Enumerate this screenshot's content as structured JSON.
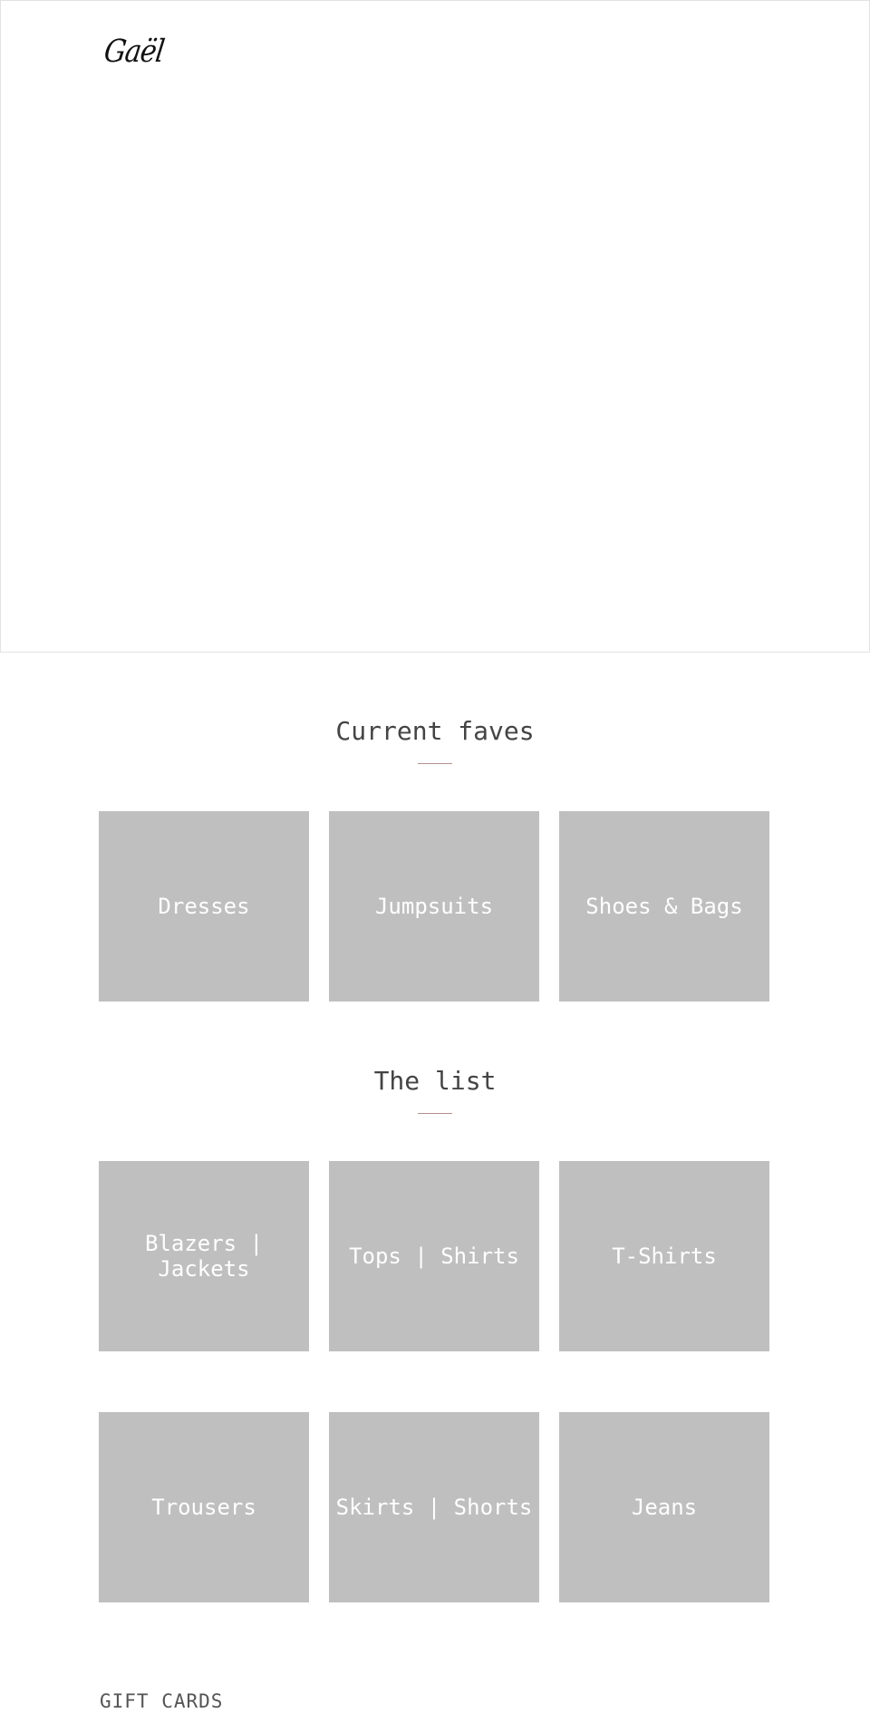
{
  "header": {
    "logo_text": "Gaël"
  },
  "sections": [
    {
      "title": "Current faves",
      "cards": [
        {
          "label": "Dresses"
        },
        {
          "label": "Jumpsuits"
        },
        {
          "label": "Shoes & Bags"
        }
      ]
    },
    {
      "title": "The list",
      "cards": [
        {
          "label": "Blazers | Jackets"
        },
        {
          "label": "Tops | Shirts"
        },
        {
          "label": "T-Shirts"
        },
        {
          "label": "Trousers"
        },
        {
          "label": "Skirts | Shorts"
        },
        {
          "label": "Jeans"
        }
      ]
    }
  ],
  "footer": {
    "gift_cards_heading": "GIFT CARDS"
  },
  "colors": {
    "card_background": "#bfbfbf",
    "accent_rule": "#b58f8c",
    "heading_text": "#444444"
  }
}
